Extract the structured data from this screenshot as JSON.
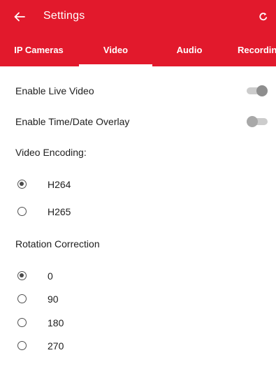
{
  "header": {
    "title": "Settings",
    "back_icon": "arrow-left-icon",
    "refresh_icon": "refresh-icon",
    "color": "#e2192c"
  },
  "tabs": [
    {
      "label": "IP Cameras",
      "selected": false
    },
    {
      "label": "Video",
      "selected": true
    },
    {
      "label": "Audio",
      "selected": false
    },
    {
      "label": "Recordin",
      "selected": false
    }
  ],
  "toggles": [
    {
      "label": "Enable Live Video",
      "on": true
    },
    {
      "label": "Enable Time/Date Overlay",
      "on": false
    }
  ],
  "video_encoding": {
    "label": "Video Encoding:",
    "options": [
      {
        "label": "H264",
        "checked": true
      },
      {
        "label": "H265",
        "checked": false
      }
    ]
  },
  "rotation_correction": {
    "label": "Rotation Correction",
    "options": [
      {
        "label": "0",
        "checked": true
      },
      {
        "label": "90",
        "checked": false
      },
      {
        "label": "180",
        "checked": false
      },
      {
        "label": "270",
        "checked": false
      }
    ]
  }
}
